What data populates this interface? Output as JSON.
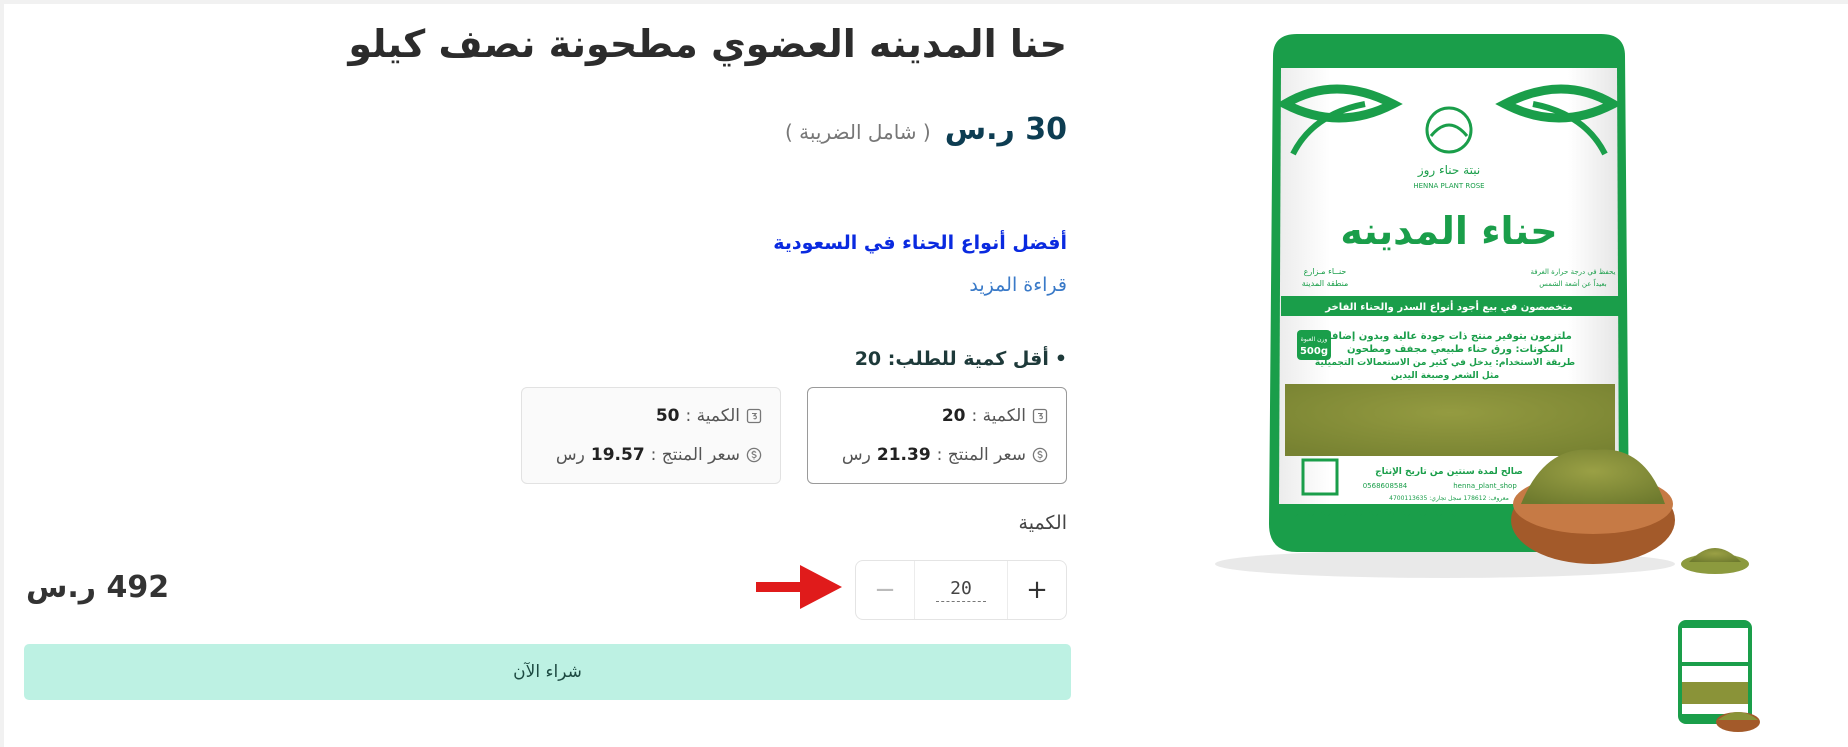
{
  "product": {
    "title": "حنا المدينه العضوي مطحونة نصف كيلو",
    "price": "30 ر.س",
    "tax_note": "( شامل الضريبة )",
    "promo_link": "أفضل أنواع الحناء في السعودية",
    "read_more": "قراءة المزيد"
  },
  "min_order": {
    "bullet": "•",
    "label": "أقل كمية للطلب: 20"
  },
  "tiers": [
    {
      "qty_label": "الكمية :",
      "qty_value": "20",
      "price_label": "سعر المنتج :",
      "price_value": "21.39",
      "currency": "رس",
      "selected": true
    },
    {
      "qty_label": "الكمية :",
      "qty_value": "50",
      "price_label": "سعر المنتج :",
      "price_value": "19.57",
      "currency": "رس",
      "selected": false
    }
  ],
  "quantity": {
    "label": "الكمية",
    "value": "20",
    "plus": "+",
    "minus": "−"
  },
  "total": "492 ر.س",
  "buy_now_label": "شراء الآن",
  "package": {
    "brand_ar": "نبتة حناء روز",
    "brand_en": "HENNA PLANT ROSE",
    "product_name": "حناء المدينه",
    "left_note_1": "حنــاء مـزارع",
    "left_note_2": "منطقة المدينة",
    "right_note_1": "يحفظ في درجة حرارة الغرفة",
    "right_note_2": "بعيداً عن أشعة الشمس",
    "band": "متخصصون في بيع أجود أنواع السدر والحناء الفاخر",
    "weight_label": "وزن العبوة",
    "weight": "500g",
    "desc_1": "ملتزمون بتوفير منتج ذات جودة عالية وبدون إضافات",
    "desc_2": "المكونات: ورق حناء طبيعي مجفف ومطحون",
    "desc_3": "طريقة الاستخدام: يدخل في كثير من الاستعمالات التجميلية",
    "desc_4": "مثل الشعر وصبغة اليدين",
    "validity": "صالح لمدة سنتين من تاريخ الإنتاج",
    "phone": "0568608584",
    "handle": "henna_plant_shop",
    "footer_small": "معروف: 178612   سجل تجاري: 4700113635"
  },
  "colors": {
    "brand_green": "#1a9e4a",
    "price_navy": "#0d3d52",
    "link_blue": "#0a2ae0",
    "buy_button_bg": "#bdf1e3",
    "arrow_red": "#e01b1b"
  }
}
